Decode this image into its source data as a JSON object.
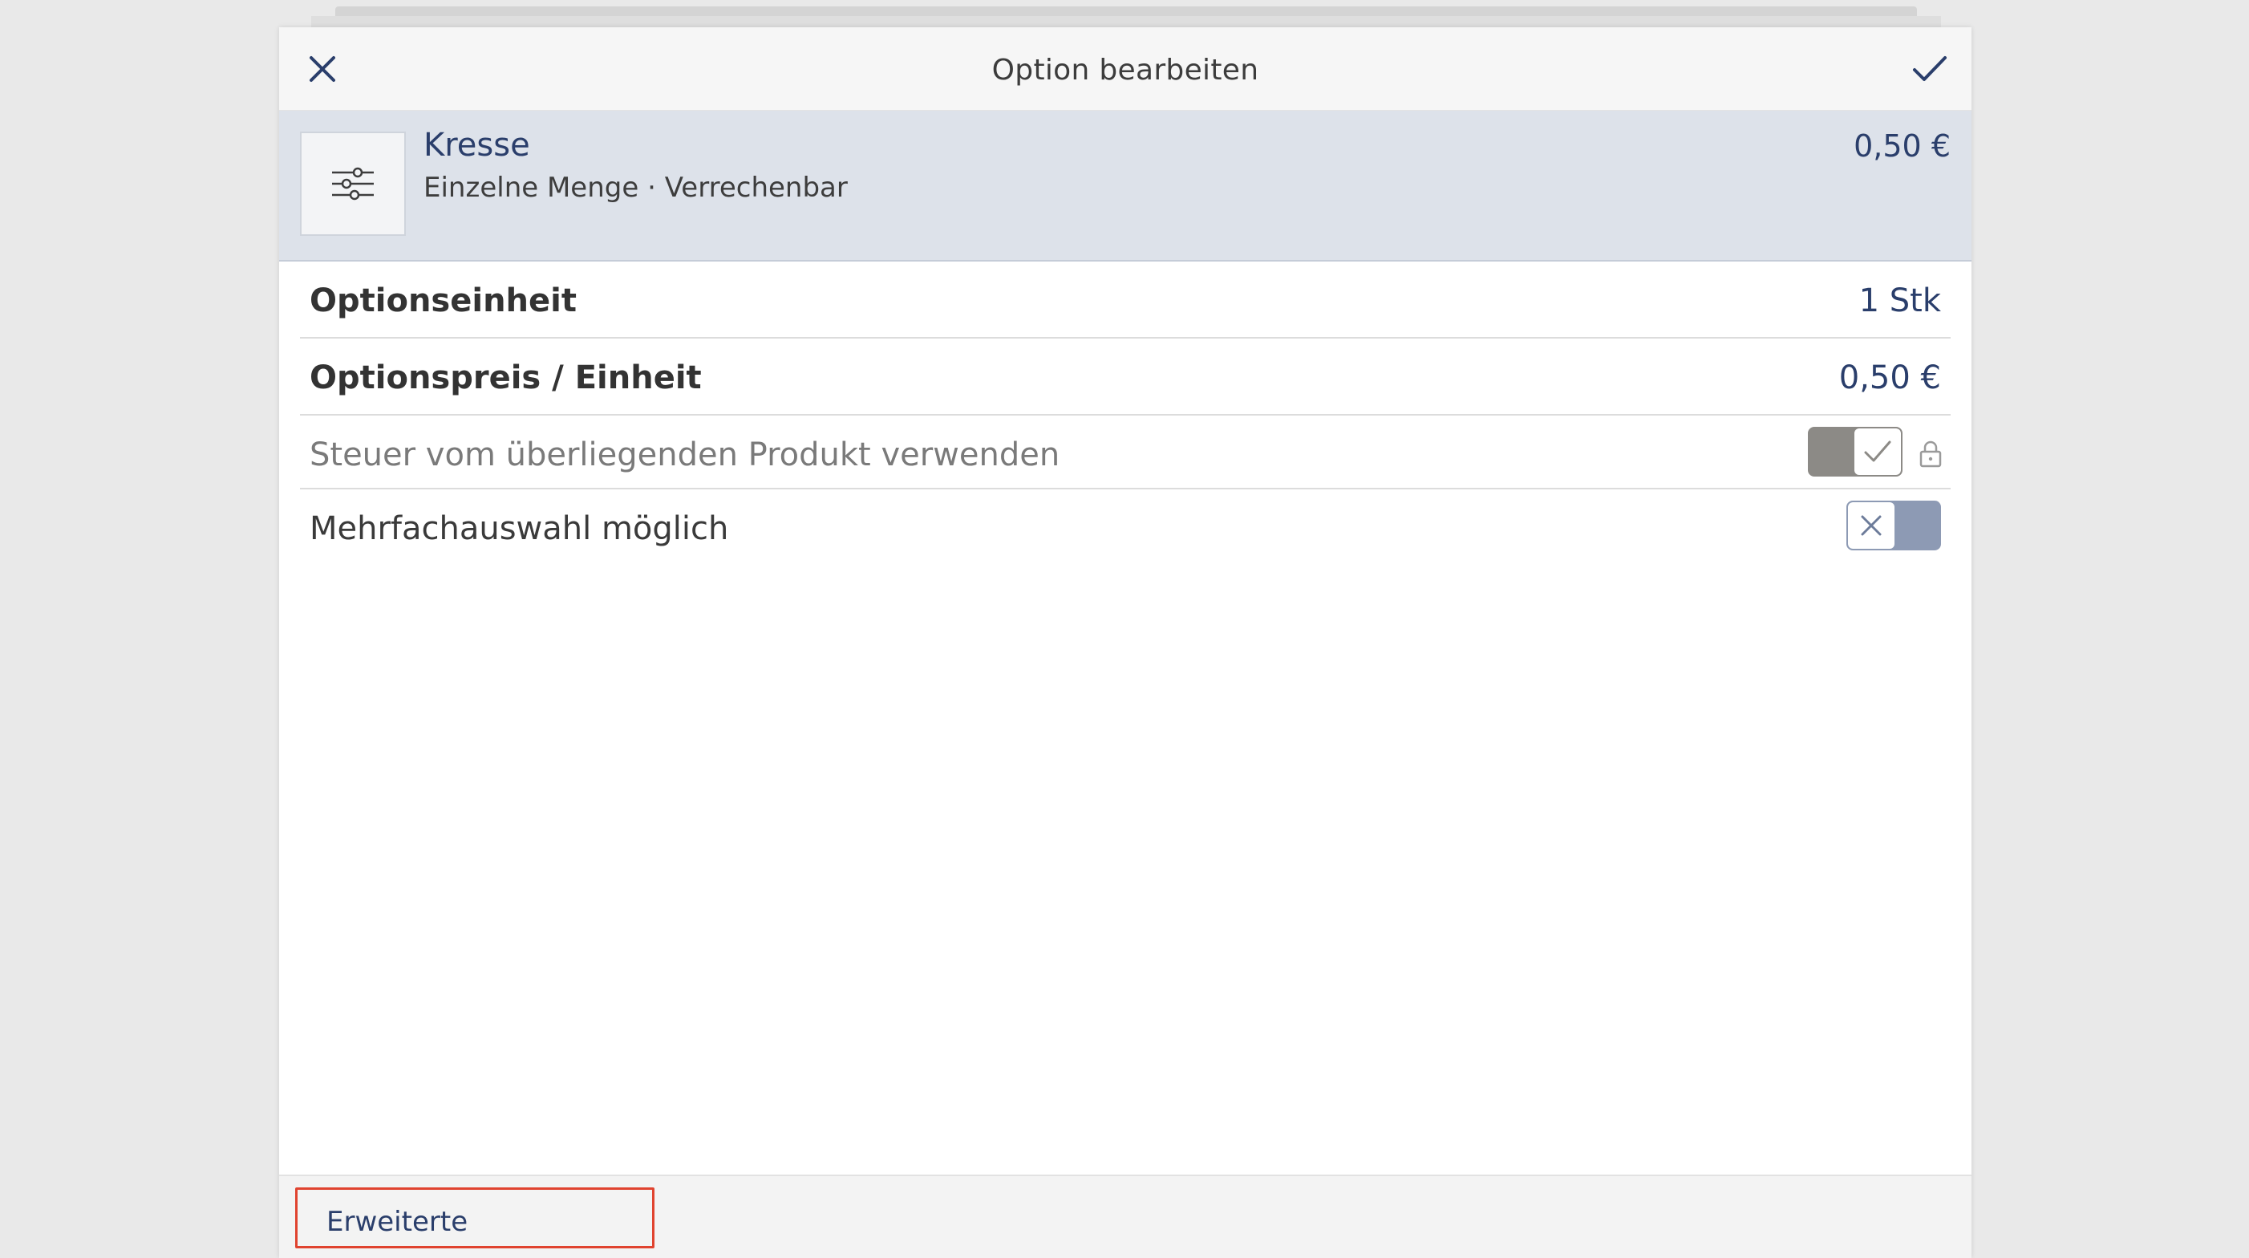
{
  "header": {
    "title": "Option bearbeiten",
    "close_icon": "close-icon",
    "confirm_icon": "checkmark-icon"
  },
  "product": {
    "name": "Kresse",
    "subtitle": "Einzelne Menge · Verrechenbar",
    "price": "0,50 €",
    "icon": "sliders-icon"
  },
  "settings": {
    "unit": {
      "label": "Optionseinheit",
      "value": "1 Stk"
    },
    "price_per_unit": {
      "label": "Optionspreis / Einheit",
      "value": "0,50 €"
    },
    "tax_from_parent": {
      "label": "Steuer vom überliegenden Produkt verwenden",
      "enabled": true,
      "locked": true
    },
    "multi_select": {
      "label": "Mehrfachauswahl möglich",
      "enabled": false
    }
  },
  "footer": {
    "advanced_label": "Erweiterte Einstellungen"
  },
  "colors": {
    "accent": "#2a3e6b",
    "highlight_border": "#e0432f",
    "product_bg": "#dde2ea"
  }
}
